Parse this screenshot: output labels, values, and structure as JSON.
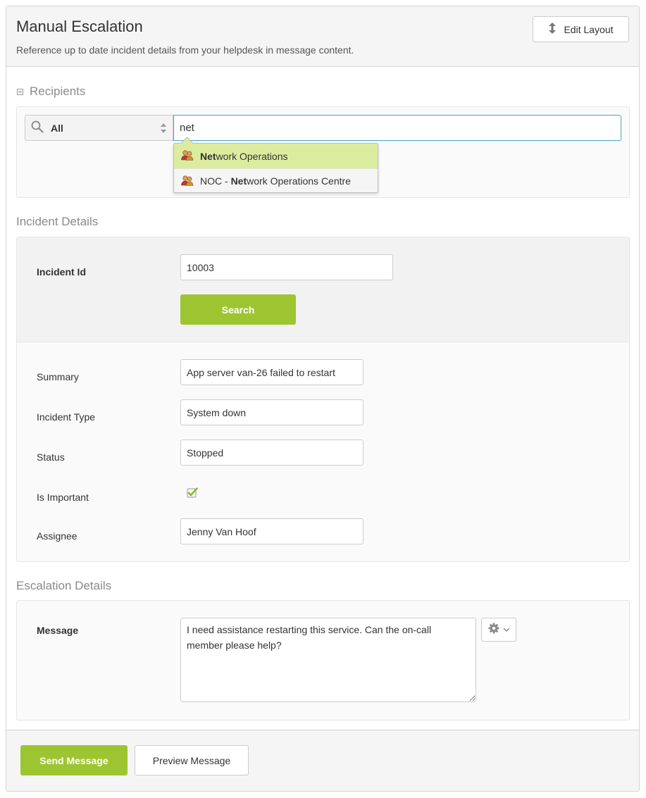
{
  "header": {
    "title": "Manual Escalation",
    "subtitle": "Reference up to date incident details from your helpdesk in message content.",
    "edit_layout_label": "Edit Layout"
  },
  "recipients": {
    "section_title": "Recipients",
    "filter_value": "All",
    "search_value": "net",
    "suggestions": [
      {
        "prefix": "",
        "match": "Net",
        "suffix": "work Operations",
        "icon": "group-icon",
        "highlighted": true
      },
      {
        "prefix": "NOC - ",
        "match": "Net",
        "suffix": "work Operations Centre",
        "icon": "group-icon",
        "highlighted": false
      }
    ]
  },
  "incident": {
    "section_title": "Incident Details",
    "id_label": "Incident Id",
    "id_value": "10003",
    "search_button": "Search",
    "summary_label": "Summary",
    "summary_value": "App server van-26 failed to restart",
    "type_label": "Incident Type",
    "type_value": "System down",
    "status_label": "Status",
    "status_value": "Stopped",
    "important_label": "Is Important",
    "important_checked": true,
    "assignee_label": "Assignee",
    "assignee_value": "Jenny Van Hoof"
  },
  "escalation": {
    "section_title": "Escalation Details",
    "message_label": "Message",
    "message_value": "I need assistance restarting this service. Can the on-call member please help?"
  },
  "footer": {
    "send_button": "Send Message",
    "preview_button": "Preview Message"
  },
  "colors": {
    "accent_green": "#9dc531",
    "highlight_green": "#dcec9f",
    "focus_blue": "#4aa3c8"
  }
}
